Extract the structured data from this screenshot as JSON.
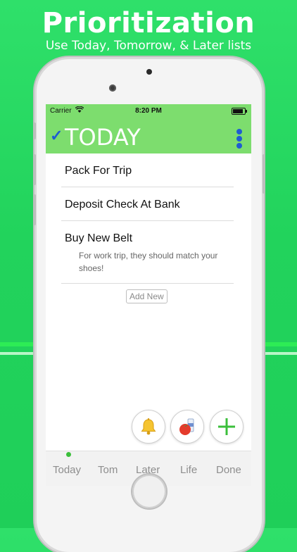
{
  "promo": {
    "headline": "Prioritization",
    "subhead": "Use Today, Tomorrow, & Later lists"
  },
  "status_bar": {
    "carrier": "Carrier",
    "time": "8:20 PM"
  },
  "navbar": {
    "title": "TODAY"
  },
  "tasks": [
    {
      "title": "Pack For Trip",
      "note": ""
    },
    {
      "title": "Deposit Check At Bank",
      "note": ""
    },
    {
      "title": "Buy New Belt",
      "note": "For work trip, they should match your shoes!"
    }
  ],
  "add_new_label": "Add New",
  "action_buttons": [
    {
      "icon": "bell-icon"
    },
    {
      "icon": "groceries-icon"
    },
    {
      "icon": "plus-icon"
    }
  ],
  "tabs": [
    {
      "label": "Today",
      "active": true
    },
    {
      "label": "Tom",
      "active": false
    },
    {
      "label": "Later",
      "active": false
    },
    {
      "label": "Life",
      "active": false
    },
    {
      "label": "Done",
      "active": false
    }
  ],
  "colors": {
    "background": "#22d35c",
    "navbar": "#7ddd6e",
    "accent": "#1f5cd1",
    "plus": "#3bbf3b"
  }
}
